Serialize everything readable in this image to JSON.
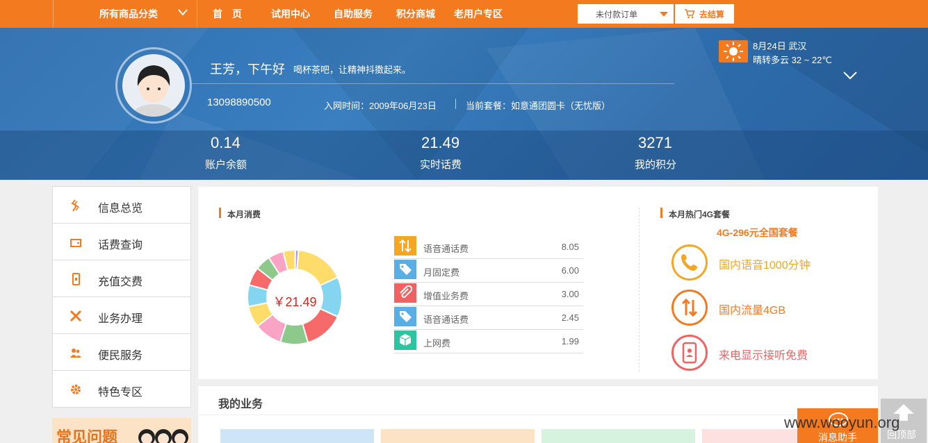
{
  "topnav": {
    "category_label": "所有商品分类",
    "links": [
      "首　页",
      "试用中心",
      "自助服务",
      "积分商城",
      "老用户专区"
    ],
    "unpaid_orders": "未付款订单",
    "checkout": "去结算"
  },
  "profile": {
    "greeting": "王芳，下午好",
    "greeting_sub": "喝杯茶吧，让精神抖擞起来。",
    "phone": "13098890500",
    "joined": "入网时间：2009年06月23日",
    "plan": "当前套餐：如意通团圆卡（无忧版）"
  },
  "weather": {
    "date_city": "8月24日 武汉",
    "desc": "晴转多云 32 ~ 22℃",
    "icon": "sun-icon"
  },
  "stats": [
    {
      "value": "0.14",
      "label": "账户余额"
    },
    {
      "value": "21.49",
      "label": "实时话费"
    },
    {
      "value": "3271",
      "label": "我的积分"
    }
  ],
  "sidebar": {
    "items": [
      {
        "label": "信息总览",
        "icon": "overview-icon"
      },
      {
        "label": "话费查询",
        "icon": "wallet-icon"
      },
      {
        "label": "充值交费",
        "icon": "phone-recharge-icon"
      },
      {
        "label": "业务办理",
        "icon": "tools-icon"
      },
      {
        "label": "便民服务",
        "icon": "people-icon"
      },
      {
        "label": "特色专区",
        "icon": "gear-icon"
      }
    ],
    "faq_title": "常见问题"
  },
  "monthly": {
    "title": "本月消费",
    "total": "￥21.49",
    "fees": [
      {
        "name": "语音通话费",
        "amount": "8.05",
        "icon": "arrows-updown-icon",
        "color": "#f5a623"
      },
      {
        "name": "月固定费",
        "amount": "6.00",
        "icon": "tag-icon",
        "color": "#5aaee6"
      },
      {
        "name": "增值业务费",
        "amount": "3.00",
        "icon": "paperclip-icon",
        "color": "#f26161"
      },
      {
        "name": "语音通话费",
        "amount": "2.45",
        "icon": "tag-icon",
        "color": "#5aaee6"
      },
      {
        "name": "上网费",
        "amount": "1.99",
        "icon": "cube-icon",
        "color": "#2ec4a0"
      }
    ]
  },
  "chart_data": {
    "type": "pie",
    "categories": [
      "",
      "",
      "",
      "",
      "",
      "",
      "",
      "",
      "",
      "",
      "",
      ""
    ],
    "values": [
      16,
      13,
      13,
      9,
      9,
      7,
      7,
      6,
      5,
      5,
      4,
      1
    ],
    "colors": [
      "#fedc6a",
      "#84d5ef",
      "#f76a6a",
      "#8cc98a",
      "#f9a3c5",
      "#fedc6a",
      "#84d5ef",
      "#f76a6a",
      "#8cc98a",
      "#f9a3c5",
      "#fedc6a",
      "#a895e0"
    ]
  },
  "hot_pkg": {
    "title": "本月热门4G套餐",
    "name": "4G-296元全国套餐",
    "features": [
      {
        "label": "国内语音1000分钟",
        "icon": "phone-handset-icon",
        "color": "#f5a623"
      },
      {
        "label": "国内流量4GB",
        "icon": "arrows-updown-icon",
        "color": "#f47a1f"
      },
      {
        "label": "来电显示接听免费",
        "icon": "mobile-user-icon",
        "color": "#f26161"
      }
    ]
  },
  "business": {
    "title": "我的业务",
    "tile_colors": [
      "#cde5f6",
      "#fde3c6",
      "#d6f3e0",
      "#fde1e1"
    ]
  },
  "floating": {
    "msg_helper": "消息助手",
    "back_top": "回顶部",
    "watermark": "www.wooyun.org"
  }
}
